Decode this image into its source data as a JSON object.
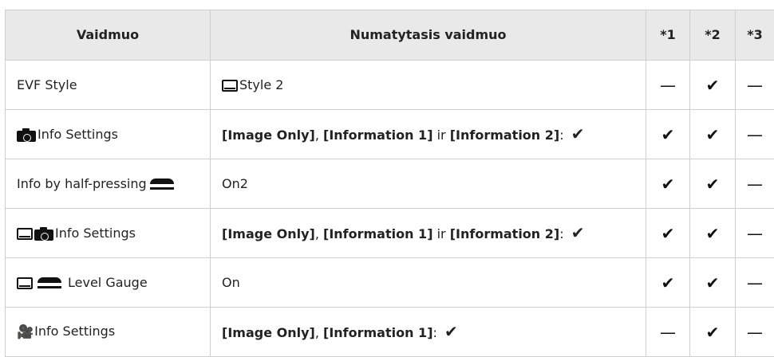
{
  "table": {
    "headers": [
      "Vaidmuo",
      "Numatytasis vaidmuo",
      "*1",
      "*2",
      "*3"
    ],
    "rows": [
      {
        "label": "EVF Style",
        "value": "Style 2",
        "marks": [
          "—",
          "✔",
          "—"
        ]
      },
      {
        "label": "Info Settings",
        "value": [
          {
            "text": "[Image Only]",
            "bold": true
          },
          {
            "text": ", ",
            "bold": false
          },
          {
            "text": "[Information 1]",
            "bold": true
          },
          {
            "text": " ir ",
            "bold": false
          },
          {
            "text": "[Information 2]",
            "bold": true
          },
          {
            "text": ": ",
            "bold": false
          },
          {
            "text": "✔",
            "bold": false
          }
        ],
        "marks": [
          "✔",
          "✔",
          "—"
        ]
      },
      {
        "label": "Info by half-pressing",
        "value": "On2",
        "marks": [
          "✔",
          "✔",
          "—"
        ]
      },
      {
        "label": "Info Settings",
        "value": [
          {
            "text": "[Image Only]",
            "bold": true
          },
          {
            "text": ", ",
            "bold": false
          },
          {
            "text": "[Information 1]",
            "bold": true
          },
          {
            "text": " ir ",
            "bold": false
          },
          {
            "text": "[Information 2]",
            "bold": true
          },
          {
            "text": ": ",
            "bold": false
          },
          {
            "text": "✔",
            "bold": false
          }
        ],
        "marks": [
          "✔",
          "✔",
          "—"
        ]
      },
      {
        "label": "Level Gauge",
        "value": "On",
        "marks": [
          "✔",
          "✔",
          "—"
        ]
      },
      {
        "label": "Info Settings",
        "value": [
          {
            "text": "[Image Only]",
            "bold": true
          },
          {
            "text": ", ",
            "bold": false
          },
          {
            "text": "[Information 1]",
            "bold": true
          },
          {
            "text": ": ",
            "bold": false
          },
          {
            "text": "✔",
            "bold": false
          }
        ],
        "marks": [
          "—",
          "✔",
          "—"
        ]
      }
    ]
  },
  "icons": {
    "row1_value": "monitor-icon",
    "row2_label": "camera-icon",
    "row3_label": "shutter-half-press-icon",
    "row4_label": [
      "monitor-icon",
      "camera-icon"
    ],
    "row5_label": [
      "monitor-icon",
      "shutter-half-press-icon"
    ],
    "row6_label": "movie-icon"
  },
  "movie_glyph": "🎥"
}
